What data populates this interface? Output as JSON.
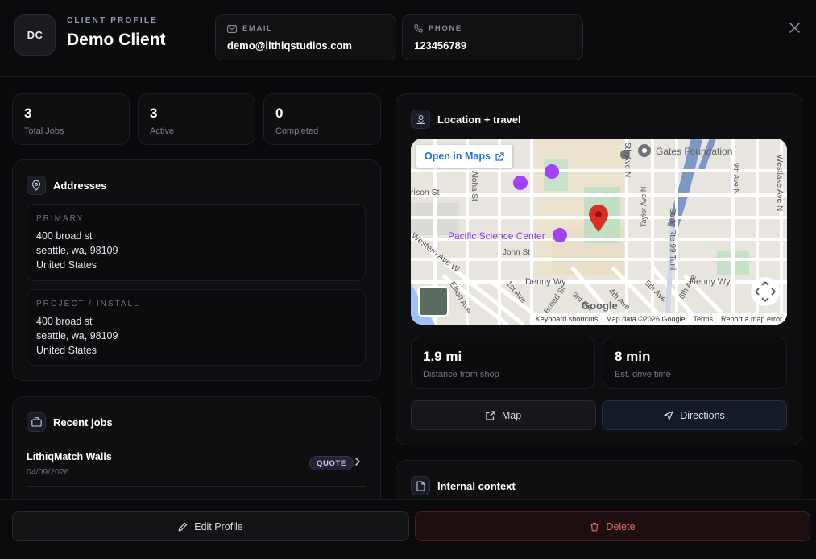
{
  "header": {
    "avatar_initials": "DC",
    "eyebrow": "CLIENT PROFILE",
    "client_name": "Demo Client",
    "email_label": "EMAIL",
    "email_value": "demo@lithiqstudios.com",
    "phone_label": "PHONE",
    "phone_value": "123456789"
  },
  "stats": [
    {
      "value": "3",
      "label": "Total Jobs"
    },
    {
      "value": "3",
      "label": "Active"
    },
    {
      "value": "0",
      "label": "Completed"
    }
  ],
  "addresses": {
    "title": "Addresses",
    "items": [
      {
        "tag": "PRIMARY",
        "line1": "400 broad st",
        "line2": "seattle, wa, 98109",
        "line3": "United States"
      },
      {
        "tag": "PROJECT / INSTALL",
        "line1": "400 broad st",
        "line2": "seattle, wa, 98109",
        "line3": "United States"
      }
    ]
  },
  "recent_jobs": {
    "title": "Recent jobs",
    "items": [
      {
        "title": "LithiqMatch Walls",
        "date": "04/09/2026",
        "status": "QUOTE"
      }
    ]
  },
  "location": {
    "title": "Location + travel",
    "map": {
      "open_in_maps": "Open in Maps",
      "labels": {
        "gates": "Gates Foundation",
        "pacific": "Pacific Science Center",
        "harrison": "rison St",
        "john": "John St",
        "denny1": "Denny Wy",
        "denny2": "Denny Wy",
        "fifth_n": "5th Ave N",
        "ninth_n": "9th Ave N",
        "westlake": "Westlake Ave N",
        "taylor": "Taylor Ave N",
        "state_rte": "State Rte 99 Tunl",
        "aloha": "Aloha St",
        "western": "Western Ave W",
        "elliott": "Elliott Ave",
        "first": "1st Ave",
        "broad": "Broad St",
        "third": "3rd Ave",
        "fourth": "4th Ave",
        "fifth": "5th Ave",
        "sixth": "6th Ave",
        "google": "Google"
      },
      "footer": {
        "shortcuts": "Keyboard shortcuts",
        "data": "Map data ©2026 Google",
        "terms": "Terms",
        "report": "Report a map error"
      }
    },
    "distance_value": "1.9 mi",
    "distance_label": "Distance from shop",
    "time_value": "8 min",
    "time_label": "Est. drive time",
    "map_button": "Map",
    "directions_button": "Directions"
  },
  "internal_context": {
    "title": "Internal context"
  },
  "footer": {
    "edit_label": "Edit Profile",
    "delete_label": "Delete"
  },
  "colors": {
    "background": "#0a0a0c",
    "card": "#0f0f12",
    "pin": "#d93025",
    "link": "#1a73e8",
    "delete_text": "#e06b6b",
    "directions_bg": "#141a26"
  }
}
